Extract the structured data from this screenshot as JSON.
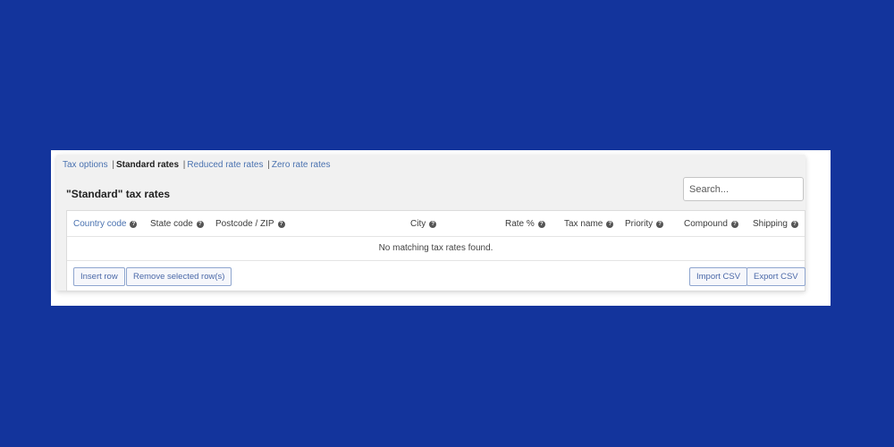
{
  "subnav": {
    "tax_options": "Tax options",
    "sep": "|",
    "standard_rates": "Standard rates",
    "reduced_rates": "Reduced rate rates",
    "zero_rates": "Zero rate rates"
  },
  "heading": "\"Standard\" tax rates",
  "search": {
    "placeholder": "Search..."
  },
  "columns": {
    "country_code": "Country code",
    "state_code": "State code",
    "postcode": "Postcode / ZIP",
    "city": "City",
    "rate": "Rate %",
    "tax_name": "Tax name",
    "priority": "Priority",
    "compound": "Compound",
    "shipping": "Shipping"
  },
  "help_glyph": "?",
  "empty_message": "No matching tax rates found.",
  "buttons": {
    "insert_row": "Insert row",
    "remove_rows": "Remove selected row(s)",
    "import_csv": "Import CSV",
    "export_csv": "Export CSV"
  },
  "colors": {
    "page_background": "#13349c",
    "link": "#4a72b0"
  }
}
